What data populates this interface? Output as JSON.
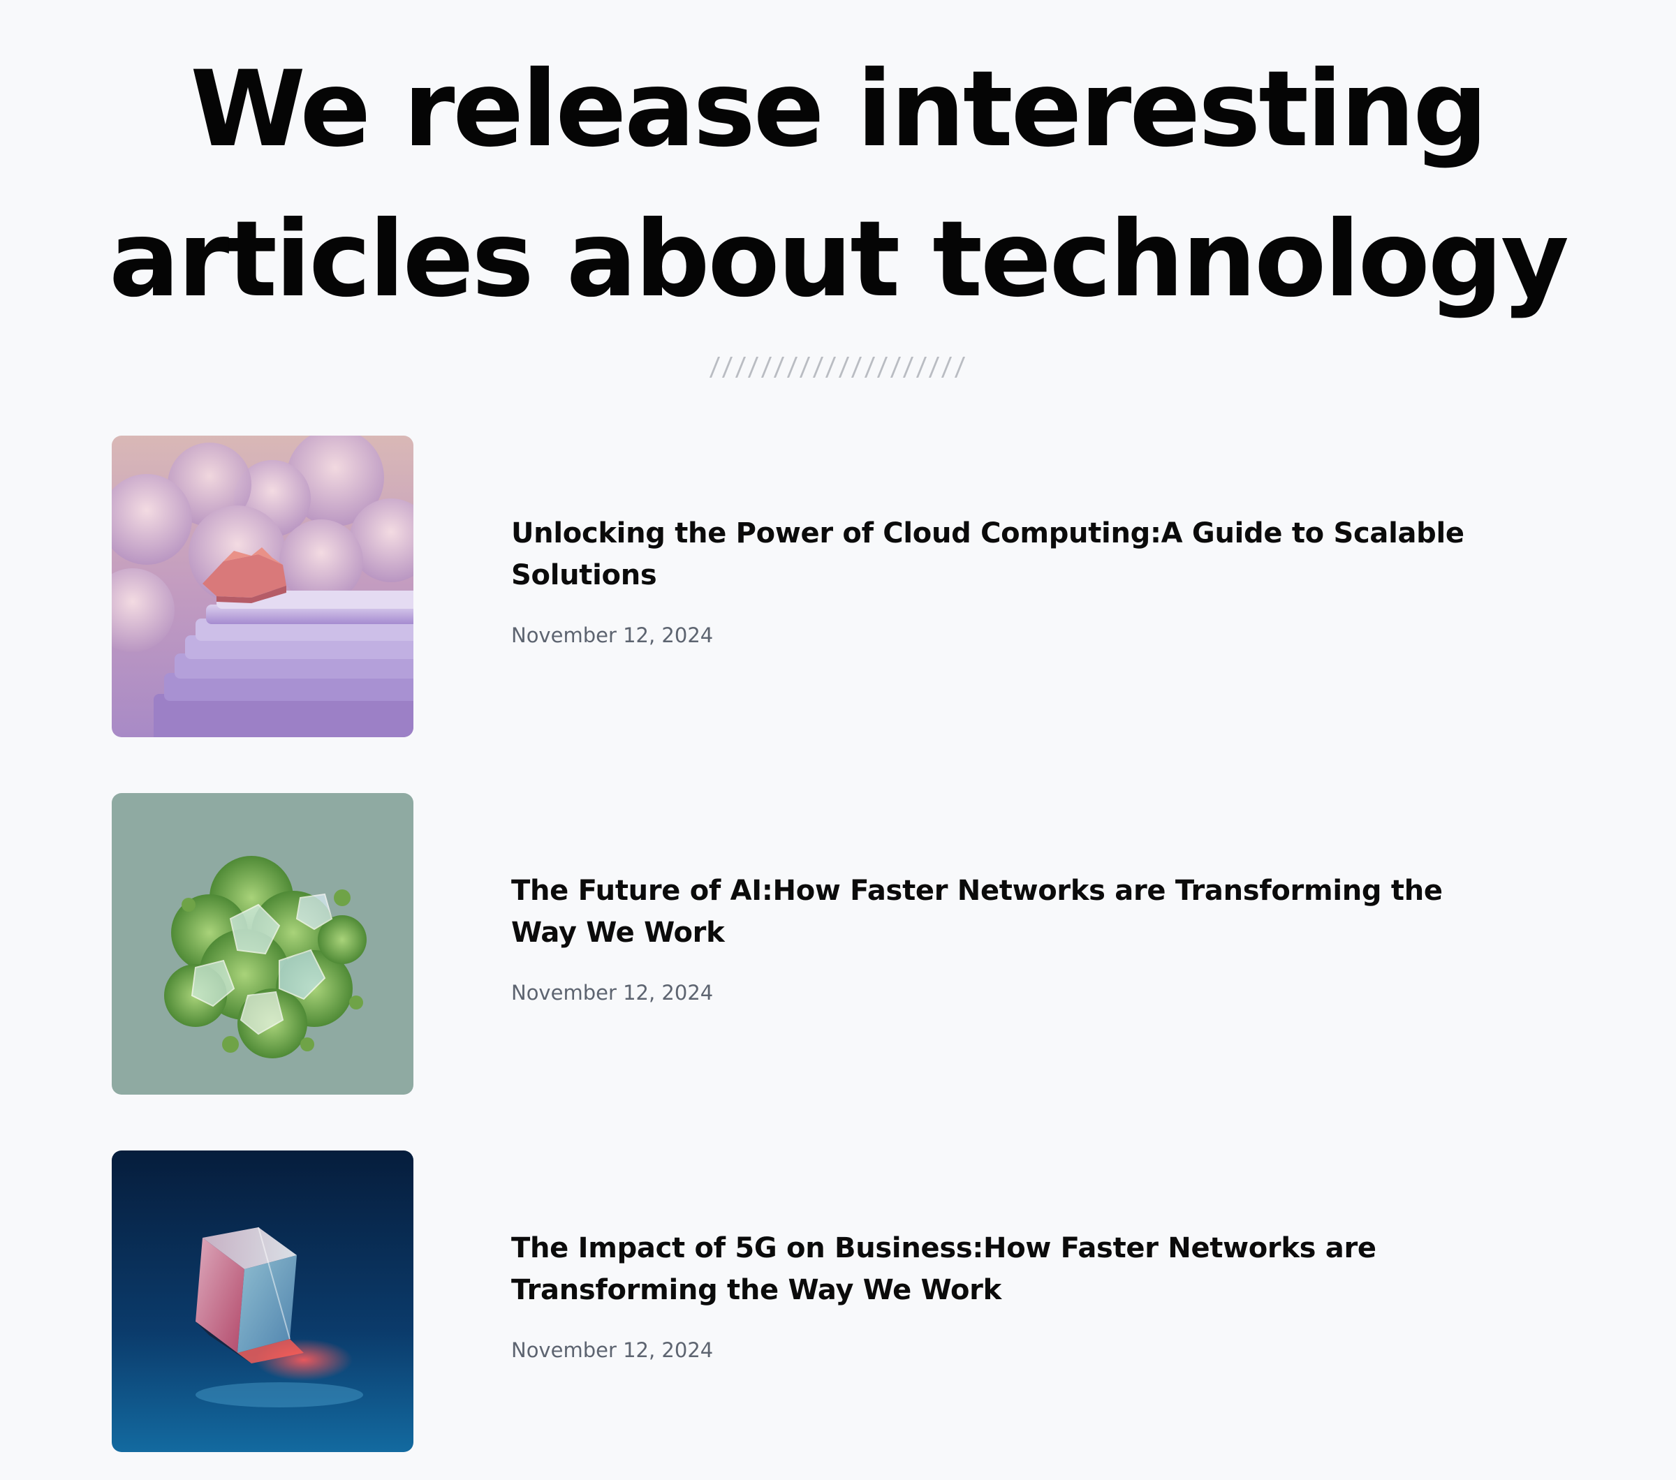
{
  "hero": {
    "title_line1": "We release interesting",
    "title_line2": "articles about technology"
  },
  "articles": [
    {
      "title": "Unlocking the Power of Cloud Computing:A Guide to Scalable Solutions",
      "date": "November 12, 2024",
      "image_icon": "cloud-steps-image"
    },
    {
      "title": "The Future of AI:How Faster Networks are Transforming the Way We Work",
      "date": "November 12, 2024",
      "image_icon": "crystal-foliage-image"
    },
    {
      "title": "The Impact of 5G on Business:How Faster Networks are Transforming the Way We Work",
      "date": "November 12, 2024",
      "image_icon": "glass-cube-image"
    }
  ],
  "colors": {
    "background": "#f8f9fb",
    "heading": "#050505",
    "date": "#5d6470",
    "divider": "#b9bcc2"
  }
}
